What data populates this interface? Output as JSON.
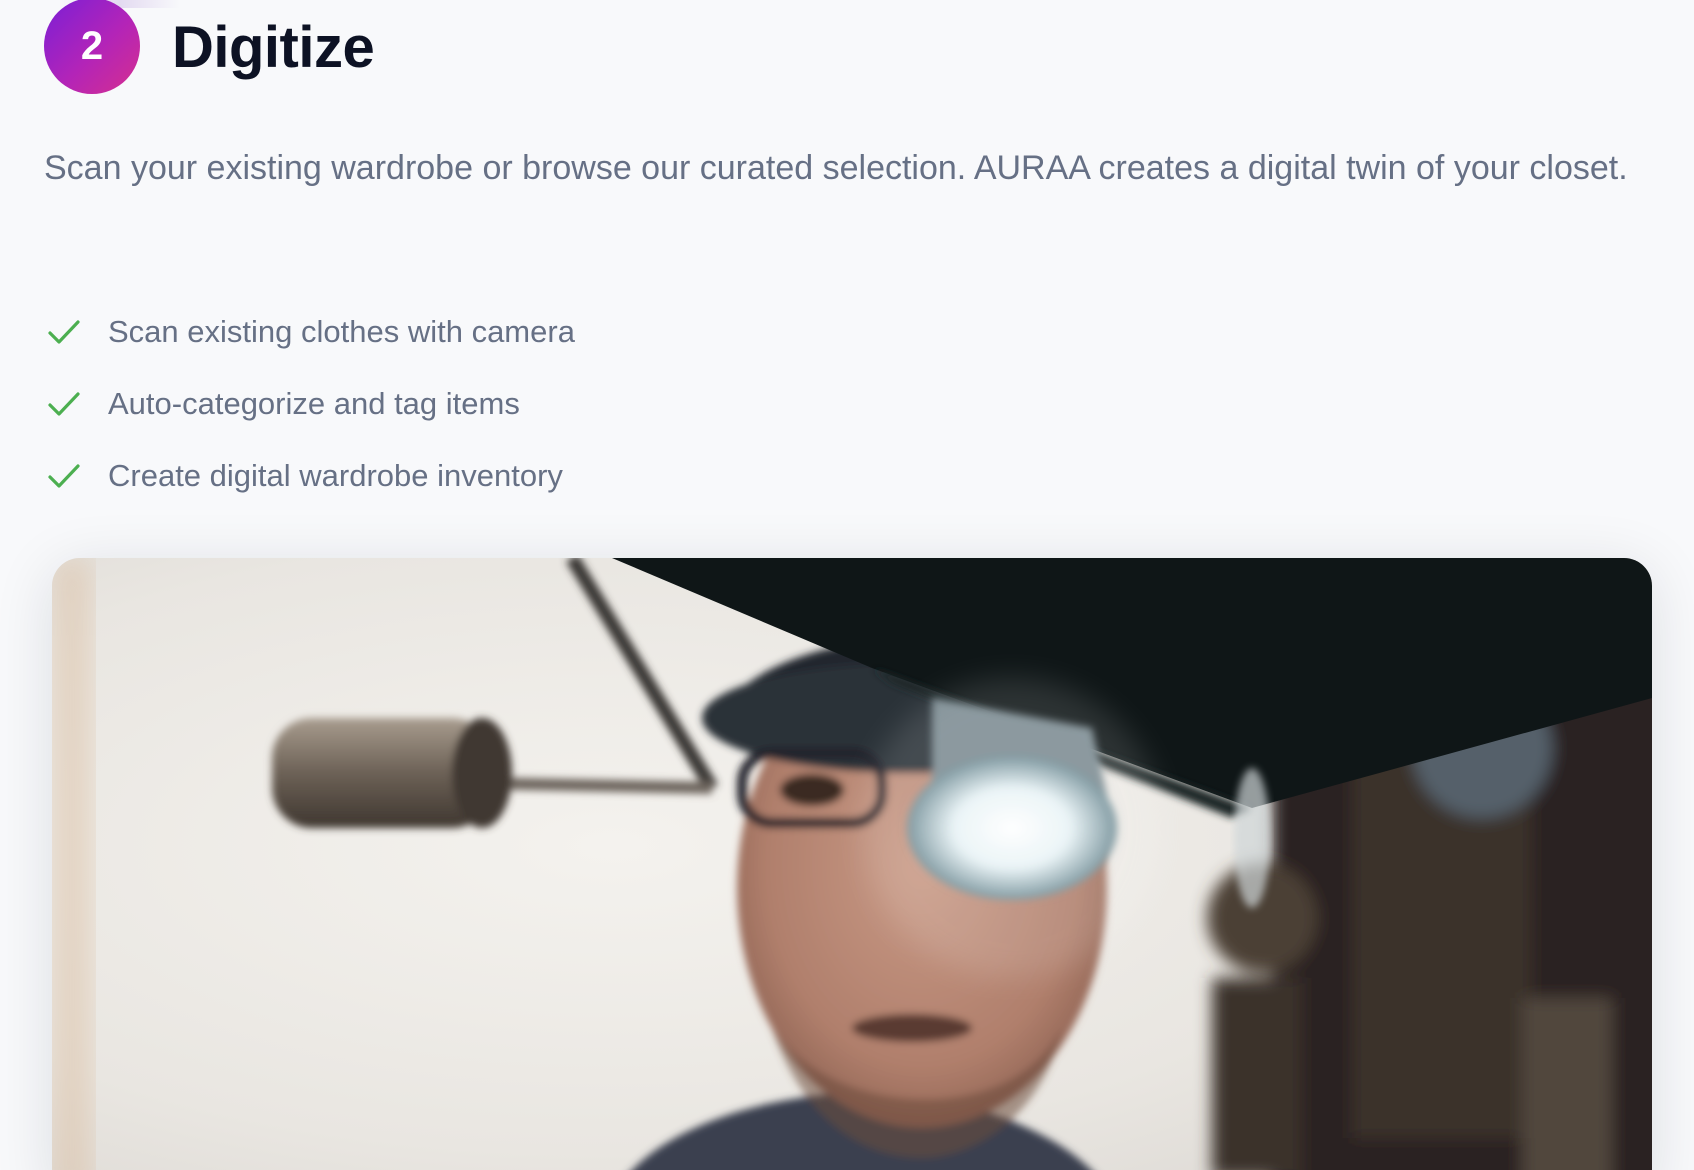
{
  "step": {
    "number": "2",
    "title": "Digitize"
  },
  "description": "Scan your existing wardrobe or browse our curated selection. AURAA creates a digital twin of your closet.",
  "features": [
    {
      "icon": "check-icon",
      "label": "Scan existing clothes with camera"
    },
    {
      "icon": "check-icon",
      "label": "Auto-categorize and tag items"
    },
    {
      "icon": "check-icon",
      "label": "Create digital wardrobe inventory"
    }
  ],
  "colors": {
    "badge_start": "#7a1fd6",
    "badge_end": "#d62f8e",
    "check": "#4caf50",
    "title": "#0d1224",
    "body_text": "#667085"
  }
}
